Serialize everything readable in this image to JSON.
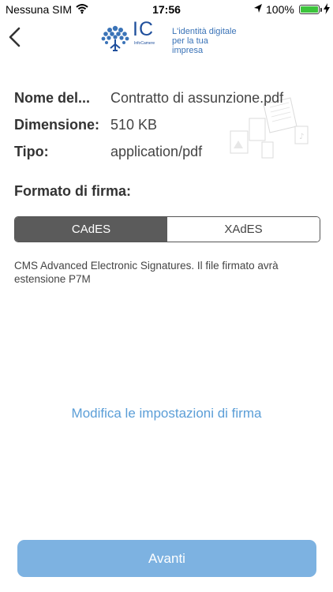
{
  "status_bar": {
    "carrier": "Nessuna SIM",
    "time": "17:56",
    "battery": "100%"
  },
  "header": {
    "logo_text": "IC",
    "logo_subtext": "InfoCamere",
    "tagline_line1": "L'identità digitale",
    "tagline_line2": "per la tua impresa"
  },
  "details": [
    {
      "label": "Nome del...",
      "value": "Contratto di assunzione.pdf"
    },
    {
      "label": "Dimensione:",
      "value": "510 KB"
    },
    {
      "label": "Tipo:",
      "value": "application/pdf"
    }
  ],
  "signature": {
    "title": "Formato di firma:",
    "options": [
      "CAdES",
      "XAdES"
    ],
    "selected": "CAdES",
    "description": "CMS Advanced Electronic Signatures. Il file firmato avrà estensione P7M"
  },
  "link_text": "Modifica le impostazioni di firma",
  "primary_button": "Avanti",
  "colors": {
    "accent": "#5b9ed7",
    "button": "#7db2e1",
    "segment_active": "#5b5b5b",
    "logo_blue": "#1f4f9c",
    "battery_green": "#3cc43c"
  }
}
